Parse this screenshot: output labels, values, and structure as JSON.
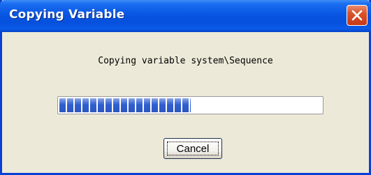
{
  "window": {
    "title": "Copying Variable",
    "close_icon": "close-x-icon"
  },
  "dialog": {
    "message": "Copying variable system\\Sequence",
    "progress": {
      "value": 0.5
    },
    "cancel_label": "Cancel"
  },
  "colors": {
    "titlebar": "#0856e2",
    "close_button": "#d8532b",
    "progress_fill": "#2f5fd0",
    "dialog_background": "#ece9d8"
  }
}
